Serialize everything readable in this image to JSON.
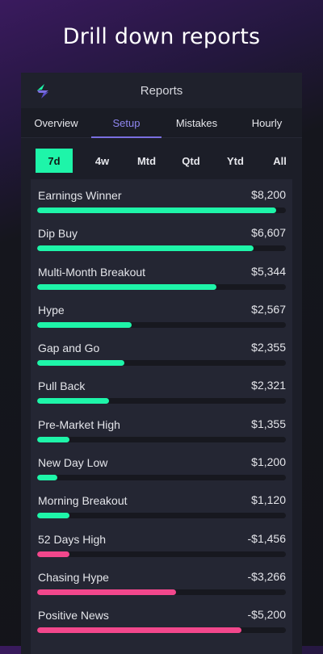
{
  "headline": "Drill down reports",
  "header": {
    "title": "Reports"
  },
  "tabs": [
    {
      "label": "Overview",
      "active": false
    },
    {
      "label": "Setup",
      "active": true
    },
    {
      "label": "Mistakes",
      "active": false
    },
    {
      "label": "Hourly",
      "active": false
    }
  ],
  "periods": [
    {
      "label": "7d",
      "active": true
    },
    {
      "label": "4w",
      "active": false
    },
    {
      "label": "Mtd",
      "active": false
    },
    {
      "label": "Qtd",
      "active": false
    },
    {
      "label": "Ytd",
      "active": false
    },
    {
      "label": "All",
      "active": false
    }
  ],
  "colors": {
    "positive": "#1ef5a9",
    "negative": "#f2478c",
    "accent": "#7a6ee0"
  },
  "setups": [
    {
      "name": "Earnings Winner",
      "value": "$8,200",
      "fraction": 0.96,
      "sign": "positive"
    },
    {
      "name": "Dip Buy",
      "value": "$6,607",
      "fraction": 0.87,
      "sign": "positive"
    },
    {
      "name": "Multi-Month Breakout",
      "value": "$5,344",
      "fraction": 0.72,
      "sign": "positive"
    },
    {
      "name": "Hype",
      "value": "$2,567",
      "fraction": 0.38,
      "sign": "positive"
    },
    {
      "name": "Gap and Go",
      "value": "$2,355",
      "fraction": 0.35,
      "sign": "positive"
    },
    {
      "name": "Pull Back",
      "value": "$2,321",
      "fraction": 0.29,
      "sign": "positive"
    },
    {
      "name": "Pre-Market High",
      "value": "$1,355",
      "fraction": 0.13,
      "sign": "positive"
    },
    {
      "name": "New Day Low",
      "value": "$1,200",
      "fraction": 0.08,
      "sign": "positive"
    },
    {
      "name": "Morning Breakout",
      "value": "$1,120",
      "fraction": 0.13,
      "sign": "positive"
    },
    {
      "name": "52 Days High",
      "value": "-$1,456",
      "fraction": 0.13,
      "sign": "negative"
    },
    {
      "name": "Chasing Hype",
      "value": "-$3,266",
      "fraction": 0.56,
      "sign": "negative"
    },
    {
      "name": "Positive News",
      "value": "-$5,200",
      "fraction": 0.82,
      "sign": "negative"
    }
  ]
}
